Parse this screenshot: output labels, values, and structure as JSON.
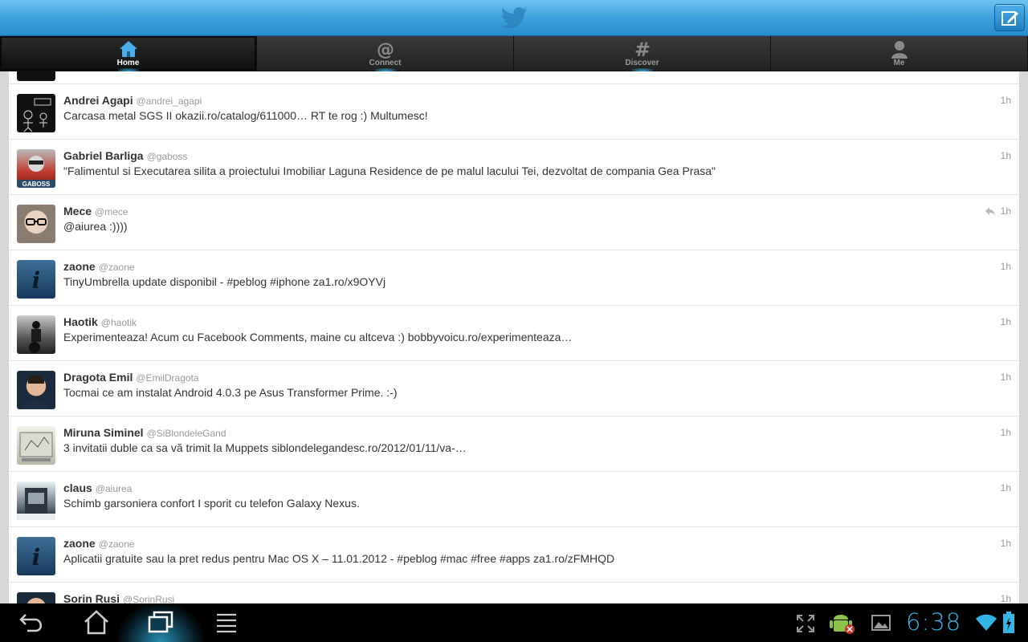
{
  "header": {
    "logo_icon": "twitter-bird-icon",
    "compose_icon": "compose-icon"
  },
  "tabs": [
    {
      "label": "Home",
      "icon": "home-icon",
      "active": true
    },
    {
      "label": "Connect",
      "icon": "at-icon",
      "active": false
    },
    {
      "label": "Discover",
      "icon": "hash-icon",
      "active": false
    },
    {
      "label": "Me",
      "icon": "person-icon",
      "active": false
    }
  ],
  "tweets": [
    {
      "name": "Andrei Agapi",
      "handle": "@andrei_agapi",
      "text": "Carcasa metal SGS II okazii.ro/catalog/611000… RT te rog :) Multumesc!",
      "time": "1h"
    },
    {
      "name": "Gabriel Barliga",
      "handle": "@gaboss",
      "text": "\"Falimentul si Executarea silita a proiectului Imobiliar Laguna Residence de pe malul lacului Tei, dezvoltat de compania Gea Prasa\"",
      "time": "1h",
      "avatar_label": "GABOSS"
    },
    {
      "name": "Mece",
      "handle": "@mece",
      "text": "@aiurea :))))",
      "time": "1h",
      "reply": true
    },
    {
      "name": "zaone",
      "handle": "@zaone",
      "text": "TinyUmbrella update disponibil - #peblog #iphone za1.ro/x9OYVj",
      "time": "1h"
    },
    {
      "name": "Haotik",
      "handle": "@haotik",
      "text": "Experimenteaza! Acum cu Facebook Comments, maine cu altceva :) bobbyvoicu.ro/experimenteaza…",
      "time": "1h"
    },
    {
      "name": "Dragota Emil",
      "handle": "@EmilDragota",
      "text": "Tocmai ce am instalat Android 4.0.3 pe Asus Transformer Prime. :-)",
      "time": "1h"
    },
    {
      "name": "Miruna Siminel",
      "handle": "@SiBlondeleGand",
      "text": "3 invitatii duble ca sa vă trimit la Muppets siblondelegandesc.ro/2012/01/11/va-…",
      "time": "1h"
    },
    {
      "name": "claus",
      "handle": "@aiurea",
      "text": "Schimb garsoniera confort I sporit cu telefon Galaxy Nexus.",
      "time": "1h"
    },
    {
      "name": "zaone",
      "handle": "@zaone",
      "text": "Aplicatii gratuite sau la pret redus pentru Mac OS X – 11.01.2012 - #peblog #mac #free #apps za1.ro/zFMHQD",
      "time": "1h"
    },
    {
      "name": "Sorin Rusi",
      "handle": "@SorinRusi",
      "text": "",
      "time": "1h"
    }
  ],
  "systembar": {
    "back_icon": "back-icon",
    "home_icon": "home-nav-icon",
    "recents_icon": "recent-apps-icon",
    "menu_icon": "menu-icon",
    "clock": "6:38"
  }
}
